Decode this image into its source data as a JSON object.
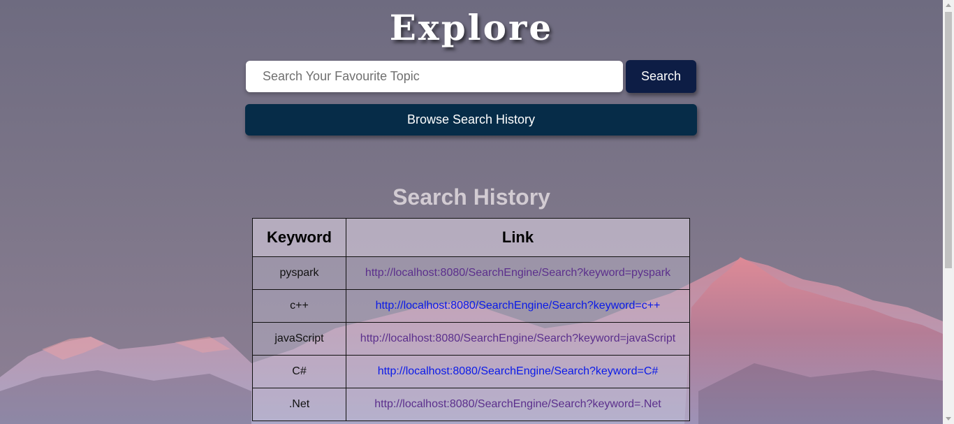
{
  "header": {
    "brand": "Explore"
  },
  "search": {
    "placeholder": "Search Your Favourite Topic",
    "value": "",
    "button_label": "Search"
  },
  "history_button": {
    "label": "Browse Search History"
  },
  "history": {
    "title": "Search History",
    "columns": [
      "Keyword",
      "Link"
    ],
    "rows": [
      {
        "keyword": "pyspark",
        "link": "http://localhost:8080/SearchEngine/Search?keyword=pyspark",
        "visited": true
      },
      {
        "keyword": "c++",
        "link": "http://localhost:8080/SearchEngine/Search?keyword=c++",
        "visited": false
      },
      {
        "keyword": "javaScript",
        "link": "http://localhost:8080/SearchEngine/Search?keyword=javaScript",
        "visited": true
      },
      {
        "keyword": "C#",
        "link": "http://localhost:8080/SearchEngine/Search?keyword=C#",
        "visited": false
      },
      {
        "keyword": ".Net",
        "link": "http://localhost:8080/SearchEngine/Search?keyword=.Net",
        "visited": true
      }
    ]
  },
  "colors": {
    "search_button_bg": "#0d1d45",
    "history_button_bg": "#062c48",
    "visited_link": "#5b2f8c",
    "unvisited_link": "#0a1ae8"
  }
}
